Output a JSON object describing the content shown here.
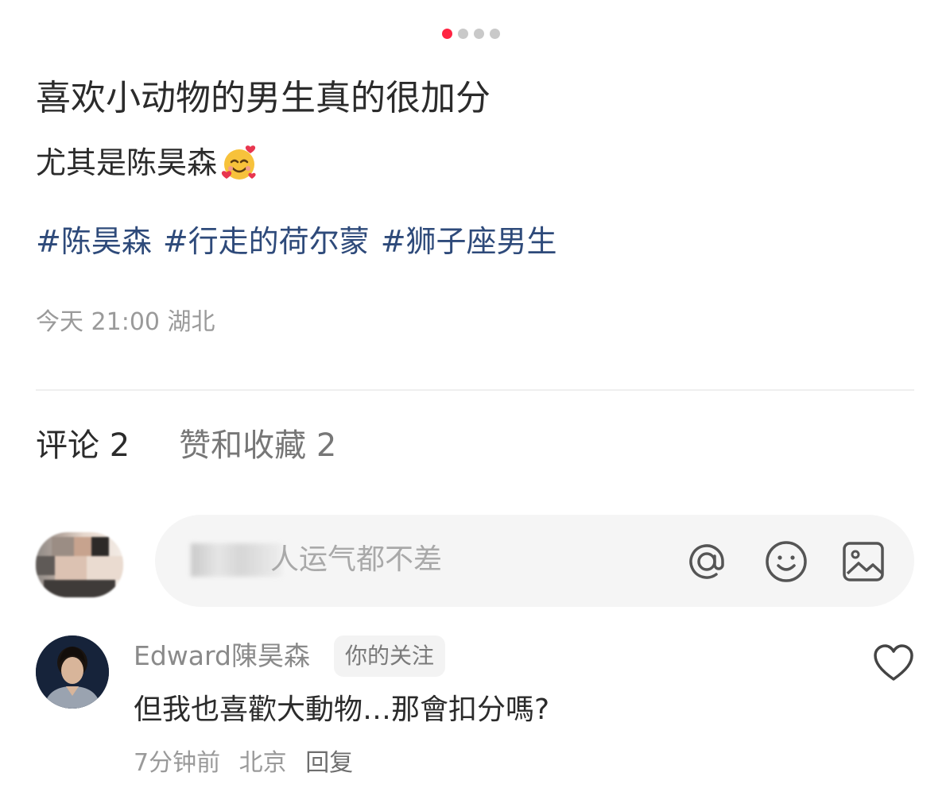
{
  "pager": {
    "count": 4,
    "active_index": 0
  },
  "post": {
    "title": "喜欢小动物的男生真的很加分",
    "subtitle": "尤其是陈昊森",
    "emoji": "smiling-face-with-hearts-icon",
    "tags": [
      "#陈昊森",
      "#行走的荷尔蒙",
      "#狮子座男生"
    ],
    "meta": "今天 21:00 湖北"
  },
  "tabs": {
    "comments": "评论 2",
    "likes": "赞和收藏 2"
  },
  "comment_input": {
    "placeholder": "人运气都不差",
    "icons": [
      "at-icon",
      "smile-icon",
      "image-icon"
    ]
  },
  "comments": [
    {
      "author": "Edward陳昊森",
      "badge": "你的关注",
      "text": "但我也喜歡大動物…那會扣分嗎?",
      "time": "7分钟前",
      "location": "北京",
      "reply_label": "回复"
    }
  ],
  "colors": {
    "accent": "#ff2442",
    "tag": "#2e4a7a",
    "text": "#2b2b2b",
    "muted": "#9a9a9a"
  }
}
